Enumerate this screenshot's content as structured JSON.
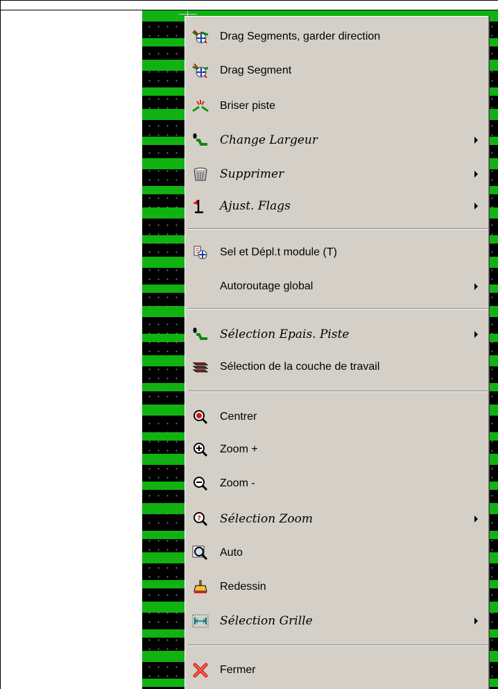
{
  "menu": {
    "items": [
      {
        "label": "Drag Segments, garder direction",
        "italic": false,
        "submenu": false,
        "icon": "drag-segments-keep-direction-icon"
      },
      {
        "label": "Drag Segment",
        "italic": false,
        "submenu": false,
        "icon": "drag-segment-icon"
      },
      {
        "label": "Briser piste",
        "italic": false,
        "submenu": false,
        "icon": "break-track-icon"
      },
      {
        "label": "Change Largeur",
        "italic": true,
        "submenu": true,
        "icon": "width-change-icon"
      },
      {
        "label": "Supprimer",
        "italic": true,
        "submenu": true,
        "icon": "trash-can-icon"
      },
      {
        "label": "Ajust. Flags",
        "italic": true,
        "submenu": true,
        "icon": "flag-icon"
      },
      {
        "label": "Sel et Dépl.t module (T)",
        "italic": false,
        "submenu": false,
        "icon": "move-module-icon"
      },
      {
        "label": "Autoroutage global",
        "italic": false,
        "submenu": true,
        "icon": ""
      },
      {
        "label": "Sélection Epais. Piste",
        "italic": true,
        "submenu": true,
        "icon": "track-width-icon"
      },
      {
        "label": "Sélection de la couche de travail",
        "italic": false,
        "submenu": false,
        "icon": "layers-icon"
      },
      {
        "label": "Centrer",
        "italic": false,
        "submenu": false,
        "icon": "zoom-center-icon"
      },
      {
        "label": "Zoom +",
        "italic": false,
        "submenu": false,
        "icon": "zoom-in-icon"
      },
      {
        "label": "Zoom -",
        "italic": false,
        "submenu": false,
        "icon": "zoom-out-icon"
      },
      {
        "label": "Sélection Zoom",
        "italic": true,
        "submenu": true,
        "icon": "zoom-select-icon"
      },
      {
        "label": "Auto",
        "italic": false,
        "submenu": false,
        "icon": "zoom-auto-icon"
      },
      {
        "label": "Redessin",
        "italic": false,
        "submenu": false,
        "icon": "redraw-icon"
      },
      {
        "label": "Sélection Grille",
        "italic": true,
        "submenu": true,
        "icon": "grid-select-icon"
      },
      {
        "label": "Fermer",
        "italic": false,
        "submenu": false,
        "icon": "close-x-icon"
      }
    ]
  }
}
